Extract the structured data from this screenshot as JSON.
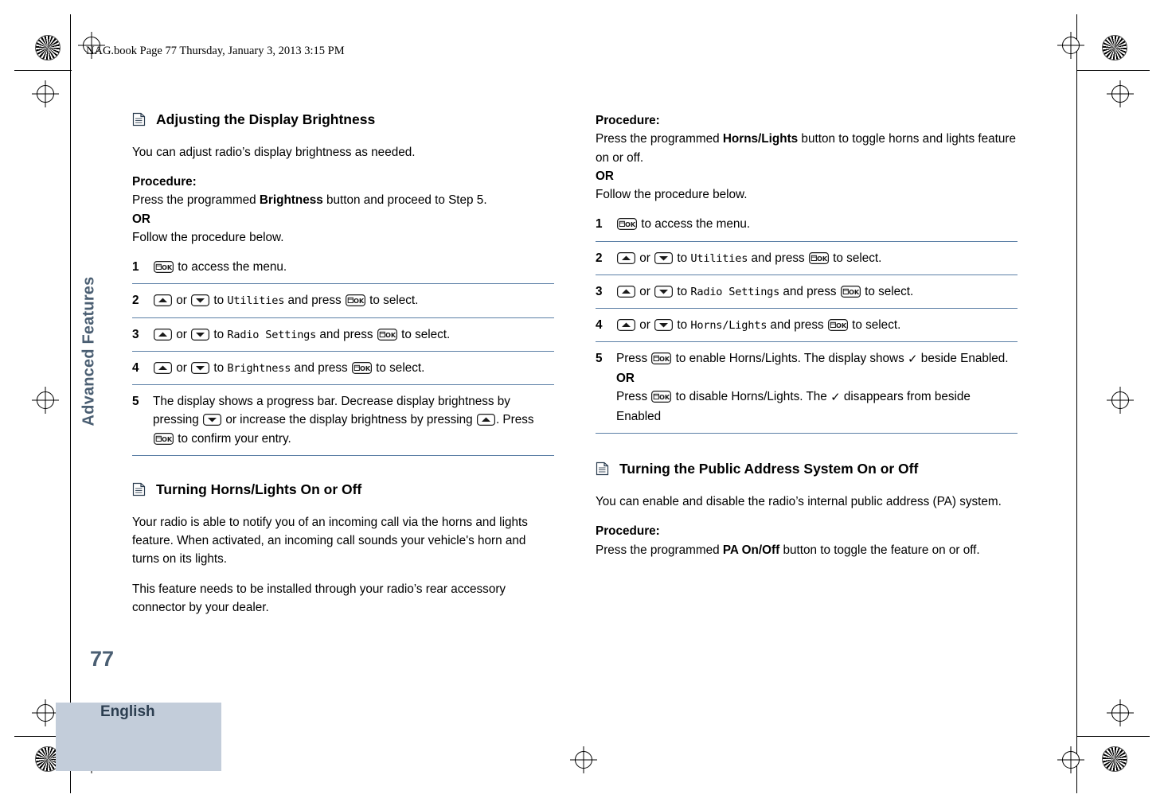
{
  "header": {
    "text": "NAG.book  Page 77  Thursday, January 3, 2013  3:15 PM"
  },
  "side_tab": {
    "label": "Advanced Features"
  },
  "footer": {
    "page_number": "77",
    "language": "English"
  },
  "left_column": {
    "section1": {
      "title": "Adjusting the Display Brightness",
      "intro": "You can adjust radio’s display brightness as needed.",
      "procedure_label": "Procedure:",
      "procedure_line1_a": "Press the programmed ",
      "procedure_line1_b": "Brightness",
      "procedure_line1_c": " button and proceed to Step 5.",
      "or": "OR",
      "follow": "Follow the procedure below.",
      "steps": [
        {
          "num": "1",
          "parts": [
            {
              "type": "key",
              "value": "ok-key"
            },
            {
              "type": "text",
              "value": " to access the menu."
            }
          ]
        },
        {
          "num": "2",
          "parts": [
            {
              "type": "key",
              "value": "up-key"
            },
            {
              "type": "text",
              "value": " or "
            },
            {
              "type": "key",
              "value": "down-key"
            },
            {
              "type": "text",
              "value": " to "
            },
            {
              "type": "mono",
              "value": "Utilities"
            },
            {
              "type": "text",
              "value": " and press "
            },
            {
              "type": "key",
              "value": "ok-key"
            },
            {
              "type": "text",
              "value": " to select."
            }
          ]
        },
        {
          "num": "3",
          "parts": [
            {
              "type": "key",
              "value": "up-key"
            },
            {
              "type": "text",
              "value": " or "
            },
            {
              "type": "key",
              "value": "down-key"
            },
            {
              "type": "text",
              "value": " to "
            },
            {
              "type": "mono",
              "value": "Radio Settings"
            },
            {
              "type": "text",
              "value": " and press "
            },
            {
              "type": "key",
              "value": "ok-key"
            },
            {
              "type": "text",
              "value": " to select."
            }
          ]
        },
        {
          "num": "4",
          "parts": [
            {
              "type": "key",
              "value": "up-key"
            },
            {
              "type": "text",
              "value": " or "
            },
            {
              "type": "key",
              "value": "down-key"
            },
            {
              "type": "text",
              "value": " to "
            },
            {
              "type": "mono",
              "value": "Brightness"
            },
            {
              "type": "text",
              "value": " and press "
            },
            {
              "type": "key",
              "value": "ok-key"
            },
            {
              "type": "text",
              "value": " to select."
            }
          ]
        },
        {
          "num": "5",
          "parts": [
            {
              "type": "text",
              "value": "The display shows a progress bar. Decrease display brightness by pressing "
            },
            {
              "type": "key",
              "value": "down-key"
            },
            {
              "type": "text",
              "value": " or increase the display brightness by pressing "
            },
            {
              "type": "key",
              "value": "up-key"
            },
            {
              "type": "text",
              "value": ". Press "
            },
            {
              "type": "key",
              "value": "ok-key"
            },
            {
              "type": "text",
              "value": " to confirm your entry."
            }
          ]
        }
      ]
    },
    "section2": {
      "title": "Turning Horns/Lights On or Off",
      "para1": "Your radio is able to notify you of an incoming call via the horns and lights feature. When activated, an incoming call sounds your vehicle's horn and turns on its lights.",
      "para2": "This feature needs to be installed through your radio’s rear accessory connector by your dealer."
    }
  },
  "right_column": {
    "continued": {
      "procedure_label": "Procedure:",
      "procedure_line_a": "Press the programmed ",
      "procedure_line_b": "Horns/Lights",
      "procedure_line_c": " button to toggle horns and lights feature on or off.",
      "or": "OR",
      "follow": "Follow the procedure below.",
      "steps": [
        {
          "num": "1",
          "parts": [
            {
              "type": "key",
              "value": "ok-key"
            },
            {
              "type": "text",
              "value": " to access the menu."
            }
          ]
        },
        {
          "num": "2",
          "parts": [
            {
              "type": "key",
              "value": "up-key"
            },
            {
              "type": "text",
              "value": " or "
            },
            {
              "type": "key",
              "value": "down-key"
            },
            {
              "type": "text",
              "value": " to "
            },
            {
              "type": "mono",
              "value": "Utilities"
            },
            {
              "type": "text",
              "value": " and press "
            },
            {
              "type": "key",
              "value": "ok-key"
            },
            {
              "type": "text",
              "value": " to select."
            }
          ]
        },
        {
          "num": "3",
          "parts": [
            {
              "type": "key",
              "value": "up-key"
            },
            {
              "type": "text",
              "value": " or "
            },
            {
              "type": "key",
              "value": "down-key"
            },
            {
              "type": "text",
              "value": " to "
            },
            {
              "type": "mono",
              "value": "Radio Settings"
            },
            {
              "type": "text",
              "value": " and press "
            },
            {
              "type": "key",
              "value": "ok-key"
            },
            {
              "type": "text",
              "value": " to select."
            }
          ]
        },
        {
          "num": "4",
          "parts": [
            {
              "type": "key",
              "value": "up-key"
            },
            {
              "type": "text",
              "value": " or "
            },
            {
              "type": "key",
              "value": "down-key"
            },
            {
              "type": "text",
              "value": " to "
            },
            {
              "type": "mono",
              "value": "Horns/Lights"
            },
            {
              "type": "text",
              "value": " and press "
            },
            {
              "type": "key",
              "value": "ok-key"
            },
            {
              "type": "text",
              "value": " to select."
            }
          ]
        },
        {
          "num": "5",
          "parts": [
            {
              "type": "text",
              "value": "Press "
            },
            {
              "type": "key",
              "value": "ok-key"
            },
            {
              "type": "text",
              "value": " to enable Horns/Lights. The display shows "
            },
            {
              "type": "check",
              "value": "✓"
            },
            {
              "type": "text",
              "value": " beside Enabled."
            },
            {
              "type": "br",
              "value": ""
            },
            {
              "type": "bold",
              "value": "OR"
            },
            {
              "type": "br",
              "value": ""
            },
            {
              "type": "text",
              "value": "Press "
            },
            {
              "type": "key",
              "value": "ok-key"
            },
            {
              "type": "text",
              "value": " to disable Horns/Lights. The "
            },
            {
              "type": "check",
              "value": "✓"
            },
            {
              "type": "text",
              "value": " disappears from beside Enabled"
            }
          ]
        }
      ]
    },
    "section3": {
      "title": "Turning the Public Address System On or Off",
      "intro": "You can enable and disable the radio’s internal public address (PA) system.",
      "procedure_label": "Procedure:",
      "procedure_line_a": "Press the programmed ",
      "procedure_line_b": "PA On/Off",
      "procedure_line_c": " button to toggle the feature on or off."
    }
  },
  "icons": {
    "book": "book-icon",
    "ok_key": "ok-key-icon",
    "up_key": "up-arrow-key-icon",
    "down_key": "down-arrow-key-icon",
    "check": "checkmark-icon"
  },
  "colors": {
    "rule": "#5b7fa6",
    "side_tab": "#4a5e72",
    "footer_bg": "#c3cdda"
  }
}
